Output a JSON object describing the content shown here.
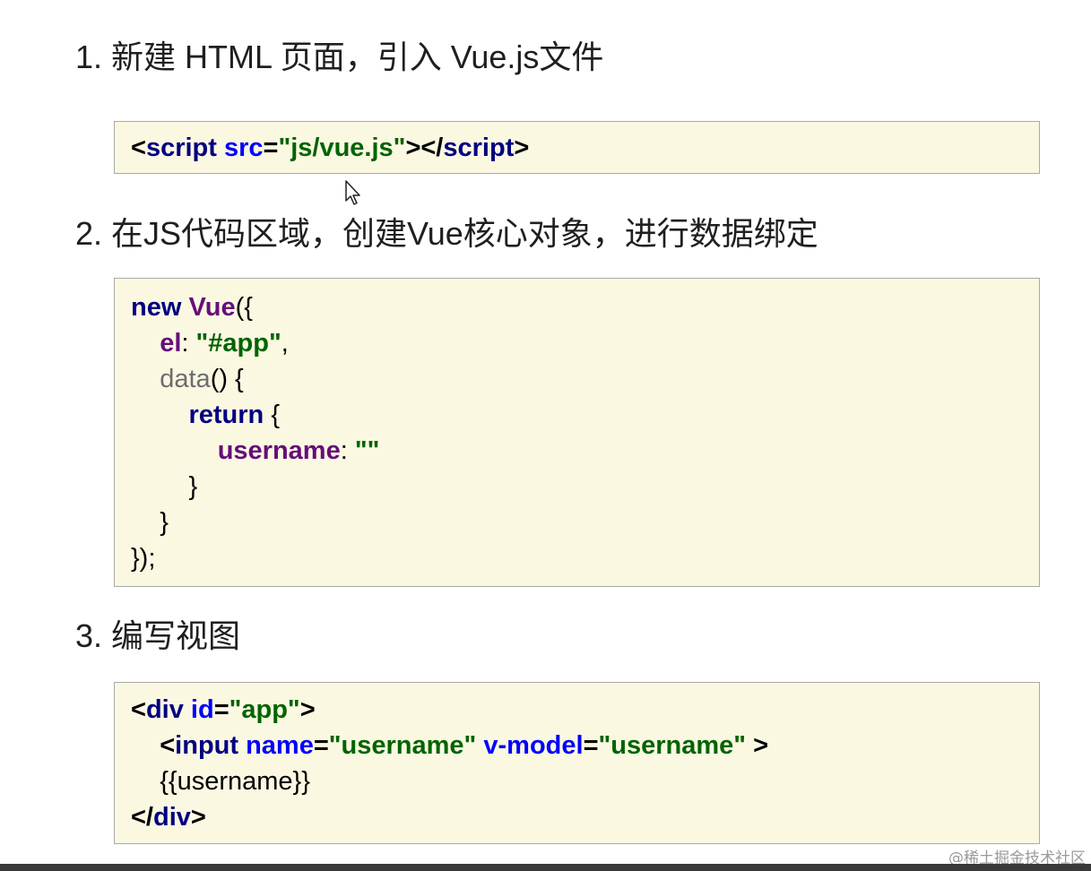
{
  "steps": [
    {
      "heading": "1. 新建 HTML 页面，引入 Vue.js文件",
      "code": {
        "l1": {
          "a": "<",
          "b": "script",
          "c": " ",
          "d": "src",
          "e": "=",
          "f": "\"js/vue.js\"",
          "g": "></",
          "h": "script",
          "i": ">"
        }
      }
    },
    {
      "heading": "2. 在JS代码区域，创建Vue核心对象，进行数据绑定",
      "code": {
        "l1": {
          "a": "new",
          "b": " ",
          "c": "Vue",
          "d": "({"
        },
        "l2": {
          "indent": "    ",
          "a": "el",
          "b": ": ",
          "c": "\"#app\"",
          "d": ","
        },
        "l3": {
          "indent": "    ",
          "a": "data",
          "b": "() {"
        },
        "l4": {
          "indent": "        ",
          "a": "return",
          "b": " {"
        },
        "l5": {
          "indent": "            ",
          "a": "username",
          "b": ": ",
          "c": "\"\""
        },
        "l6": {
          "indent": "        ",
          "a": "}"
        },
        "l7": {
          "indent": "    ",
          "a": "}"
        },
        "l8": {
          "a": "});"
        }
      }
    },
    {
      "heading": "3. 编写视图",
      "code": {
        "l1": {
          "a": "<",
          "b": "div",
          "c": " ",
          "d": "id",
          "e": "=",
          "f": "\"app\"",
          "g": ">"
        },
        "l2": {
          "indent": "    ",
          "a": "<",
          "b": "input",
          "c": " ",
          "d": "name",
          "e": "=",
          "f": "\"username\"",
          "g": " ",
          "h": "v-model",
          "i": "=",
          "j": "\"username\"",
          "k": " >"
        },
        "l3": {
          "indent": "    ",
          "a": "{{username}}"
        },
        "l4": {
          "a": "</",
          "b": "div",
          "c": ">"
        }
      }
    }
  ],
  "watermark": "@稀土掘金技术社区",
  "icons": {
    "cursor": "mouse-pointer-icon"
  }
}
